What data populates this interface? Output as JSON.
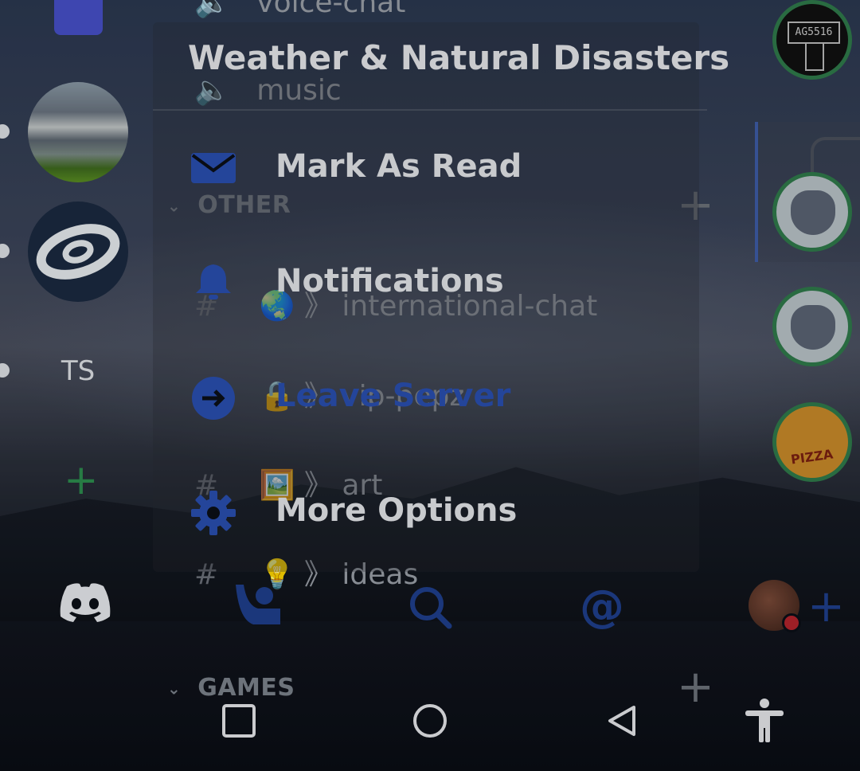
{
  "server_rail": {
    "ts_label": "TS"
  },
  "menu": {
    "title": "Weather & Natural Disasters",
    "items": [
      {
        "label": "Mark As Read",
        "icon": "envelope-icon"
      },
      {
        "label": "Notifications",
        "icon": "bell-icon"
      },
      {
        "label": "Leave Server",
        "icon": "leave-icon"
      },
      {
        "label": "More Options",
        "icon": "gear-icon"
      }
    ]
  },
  "channels": {
    "top": [
      {
        "name": "voice-chat",
        "icon": "speaker-icon"
      },
      {
        "name": "music",
        "icon": "speaker-icon"
      }
    ],
    "other_category": "OTHER",
    "other": [
      {
        "emoji": "🌏",
        "name": "international-chat"
      },
      {
        "emoji": "🔒",
        "name": "vip-pepz"
      },
      {
        "emoji": "🖼️",
        "name": "art"
      },
      {
        "emoji": "💡",
        "name": "ideas"
      }
    ],
    "games_category": "GAMES",
    "separator": "》"
  },
  "members": {
    "top_badge": "AG5516",
    "pizza_label": "PIZZA"
  },
  "colors": {
    "accent_blue": "#2a4fb0",
    "online_green": "#2f7a4a",
    "folder": "#4750c9"
  }
}
